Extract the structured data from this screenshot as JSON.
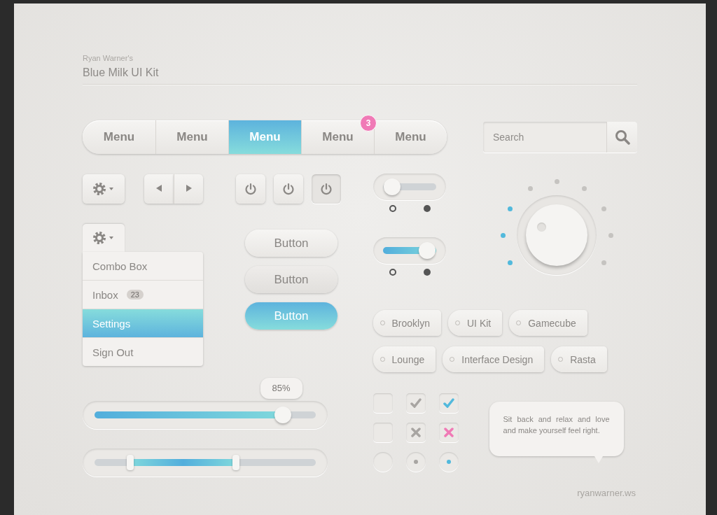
{
  "header": {
    "author": "Ryan Warner's",
    "title": "Blue Milk UI Kit"
  },
  "menu": [
    {
      "label": "Menu",
      "selected": false
    },
    {
      "label": "Menu",
      "selected": false
    },
    {
      "label": "Menu",
      "selected": true
    },
    {
      "label": "Menu",
      "selected": false,
      "badge": "3"
    },
    {
      "label": "Menu",
      "selected": false
    }
  ],
  "search": {
    "placeholder": "Search"
  },
  "power_buttons": [
    {
      "pressed": false
    },
    {
      "pressed": false
    },
    {
      "pressed": true
    }
  ],
  "combo": {
    "items": [
      {
        "label": "Combo Box",
        "selected": false
      },
      {
        "label": "Inbox",
        "badge": "23",
        "selected": false
      },
      {
        "label": "Settings",
        "selected": true
      },
      {
        "label": "Sign Out",
        "selected": false
      }
    ]
  },
  "buttons": [
    {
      "label": "Button",
      "kind": "default"
    },
    {
      "label": "Button",
      "kind": "hover"
    },
    {
      "label": "Button",
      "kind": "primary"
    }
  ],
  "toggles": [
    {
      "on": false
    },
    {
      "on": true
    }
  ],
  "knob": {
    "level": 0.33
  },
  "tags": [
    "Brooklyn",
    "UI Kit",
    "Gamecube",
    "Lounge",
    "Interface Design",
    "Rasta"
  ],
  "checks": [
    {
      "kind": "check",
      "items": [
        {
          "checked": false
        },
        {
          "checked": true,
          "active": false
        },
        {
          "checked": true,
          "active": true
        }
      ]
    },
    {
      "kind": "cross",
      "items": [
        {
          "checked": false
        },
        {
          "checked": true,
          "active": false
        },
        {
          "checked": true,
          "active": true
        }
      ]
    },
    {
      "kind": "radio",
      "items": [
        {
          "checked": false
        },
        {
          "checked": true,
          "active": false
        },
        {
          "checked": true,
          "active": true
        }
      ]
    }
  ],
  "slider": {
    "level": 0.85,
    "tooltip": "85%"
  },
  "range_slider": {
    "handles": [
      {
        "level": 0.16
      },
      {
        "level": 0.64
      }
    ]
  },
  "bubble": {
    "text": "Sit back and relax and love and make yourself feel right."
  },
  "credit": "ryanwarner.ws"
}
